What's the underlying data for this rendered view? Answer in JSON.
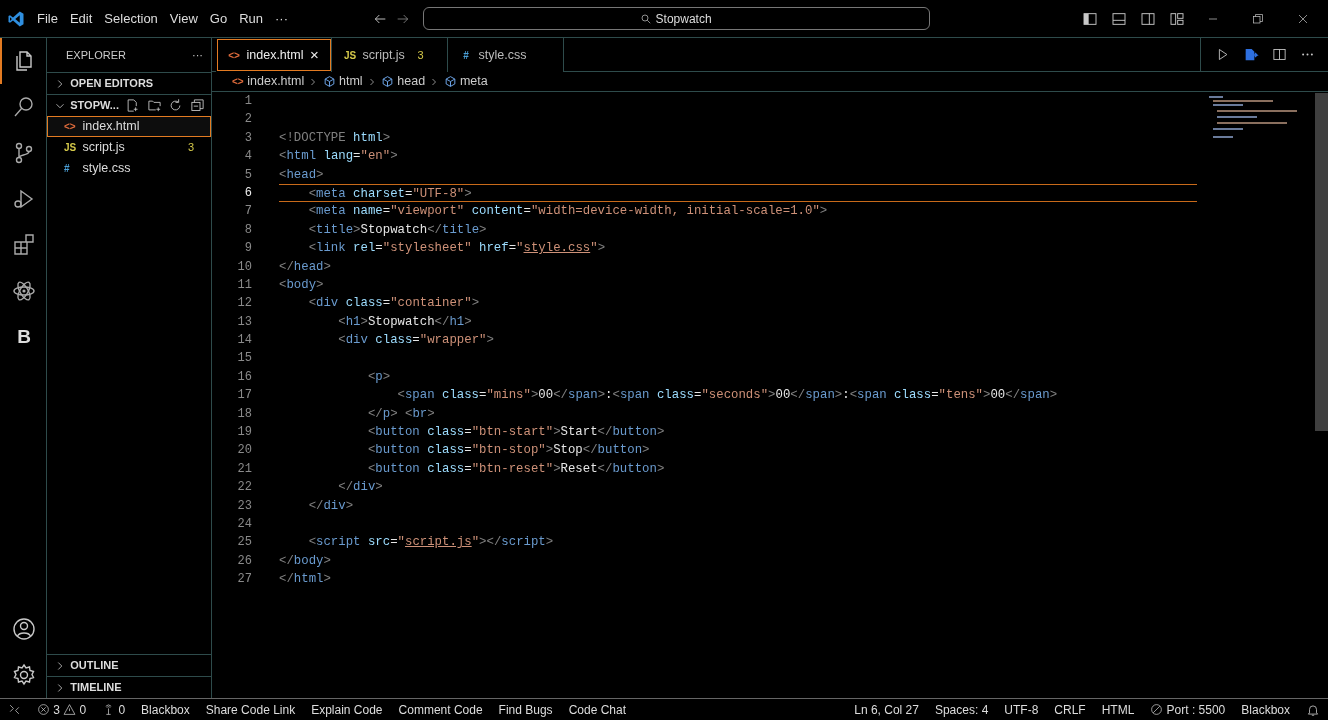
{
  "title_bar": {
    "menu": [
      "File",
      "Edit",
      "Selection",
      "View",
      "Go",
      "Run",
      "···"
    ],
    "search": {
      "value": "Stopwatch"
    }
  },
  "activity_bar": {
    "items": [
      {
        "kind": "files",
        "selected": true
      },
      {
        "kind": "search",
        "selected": false
      },
      {
        "kind": "source-control",
        "selected": false
      },
      {
        "kind": "run",
        "selected": false
      },
      {
        "kind": "extensions",
        "selected": false
      },
      {
        "kind": "atom",
        "selected": false
      },
      {
        "kind": "letter",
        "label": "B",
        "selected": false
      }
    ],
    "bottom": [
      {
        "kind": "account"
      },
      {
        "kind": "settings"
      }
    ]
  },
  "sidebar": {
    "title": "EXPLORER",
    "more": "···",
    "sections": [
      {
        "label": "OPEN EDITORS",
        "expanded": false
      },
      {
        "label": "STOPW...",
        "expanded": true
      }
    ],
    "files": [
      {
        "icon": "<>",
        "kind": "html",
        "name": "index.html",
        "selected": true
      },
      {
        "icon": "JS",
        "kind": "js",
        "name": "script.js",
        "badge": "3",
        "selected": false
      },
      {
        "icon": "#",
        "kind": "css",
        "name": "style.css",
        "selected": false
      }
    ],
    "bottom_sections": [
      {
        "label": "OUTLINE",
        "expanded": false
      },
      {
        "label": "TIMELINE",
        "expanded": false
      }
    ]
  },
  "tabs": [
    {
      "icon": "<>",
      "kind": "html",
      "label": "index.html",
      "close": "×",
      "selected": true
    },
    {
      "icon": "JS",
      "kind": "js",
      "label": "script.js",
      "badge": "3",
      "selected": false
    },
    {
      "icon": "#",
      "kind": "css",
      "label": "style.css",
      "selected": false
    }
  ],
  "breadcrumbs": [
    {
      "kind": "file",
      "icon": "<>",
      "label": "index.html"
    },
    {
      "kind": "element",
      "label": "html"
    },
    {
      "kind": "element",
      "label": "head"
    },
    {
      "kind": "element",
      "label": "meta"
    }
  ],
  "editor": {
    "lines": [
      {
        "number": "1",
        "current": false
      },
      {
        "number": "2",
        "current": false
      },
      {
        "number": "3",
        "current": false,
        "tokens": [
          {
            "kind": "punct",
            "text": "<!DOCTYPE"
          },
          {
            "kind": "attr",
            "text": " html"
          },
          {
            "kind": "punct",
            "text": ">"
          }
        ]
      },
      {
        "number": "4",
        "current": false,
        "tokens": [
          {
            "kind": "punct",
            "text": "<"
          },
          {
            "kind": "tag",
            "text": "html"
          },
          {
            "kind": "attr",
            "text": " lang"
          },
          {
            "kind": "text",
            "text": "="
          },
          {
            "kind": "value",
            "text": "\"en\""
          },
          {
            "kind": "punct",
            "text": ">"
          }
        ]
      },
      {
        "number": "5",
        "current": false,
        "tokens": [
          {
            "kind": "punct",
            "text": "<"
          },
          {
            "kind": "tag",
            "text": "head"
          },
          {
            "kind": "punct",
            "text": ">"
          }
        ]
      },
      {
        "number": "6",
        "current": true,
        "tokens": [
          {
            "kind": "punct",
            "text": "    <"
          },
          {
            "kind": "tag",
            "text": "meta"
          },
          {
            "kind": "attr",
            "text": " charset"
          },
          {
            "kind": "text",
            "text": "="
          },
          {
            "kind": "value",
            "text": "\"UTF-8\""
          },
          {
            "kind": "punct",
            "text": ">"
          }
        ]
      },
      {
        "number": "7",
        "current": false,
        "tokens": [
          {
            "kind": "punct",
            "text": "    <"
          },
          {
            "kind": "tag",
            "text": "meta"
          },
          {
            "kind": "attr",
            "text": " name"
          },
          {
            "kind": "text",
            "text": "="
          },
          {
            "kind": "value",
            "text": "\"viewport\""
          },
          {
            "kind": "attr",
            "text": " content"
          },
          {
            "kind": "text",
            "text": "="
          },
          {
            "kind": "value",
            "text": "\"width=device-width, initial-scale=1.0\""
          },
          {
            "kind": "punct",
            "text": ">"
          }
        ]
      },
      {
        "number": "8",
        "current": false,
        "tokens": [
          {
            "kind": "punct",
            "text": "    <"
          },
          {
            "kind": "tag",
            "text": "title"
          },
          {
            "kind": "punct",
            "text": ">"
          },
          {
            "kind": "text",
            "text": "Stopwatch"
          },
          {
            "kind": "punct",
            "text": "</"
          },
          {
            "kind": "tag",
            "text": "title"
          },
          {
            "kind": "punct",
            "text": ">"
          }
        ]
      },
      {
        "number": "9",
        "current": false,
        "tokens": [
          {
            "kind": "punct",
            "text": "    <"
          },
          {
            "kind": "tag",
            "text": "link"
          },
          {
            "kind": "attr",
            "text": " rel"
          },
          {
            "kind": "text",
            "text": "="
          },
          {
            "kind": "value",
            "text": "\"stylesheet\""
          },
          {
            "kind": "attr",
            "text": " href"
          },
          {
            "kind": "text",
            "text": "="
          },
          {
            "kind": "value",
            "text": "\""
          },
          {
            "kind": "link",
            "text": "style.css"
          },
          {
            "kind": "value",
            "text": "\""
          },
          {
            "kind": "punct",
            "text": ">"
          }
        ]
      },
      {
        "number": "10",
        "current": false,
        "tokens": [
          {
            "kind": "punct",
            "text": "</"
          },
          {
            "kind": "tag",
            "text": "head"
          },
          {
            "kind": "punct",
            "text": ">"
          }
        ]
      },
      {
        "number": "11",
        "current": false,
        "tokens": [
          {
            "kind": "punct",
            "text": "<"
          },
          {
            "kind": "tag",
            "text": "body"
          },
          {
            "kind": "punct",
            "text": ">"
          }
        ]
      },
      {
        "number": "12",
        "current": false,
        "tokens": [
          {
            "kind": "punct",
            "text": "    <"
          },
          {
            "kind": "tag",
            "text": "div"
          },
          {
            "kind": "attr",
            "text": " class"
          },
          {
            "kind": "text",
            "text": "="
          },
          {
            "kind": "value",
            "text": "\"container\""
          },
          {
            "kind": "punct",
            "text": ">"
          }
        ]
      },
      {
        "number": "13",
        "current": false,
        "tokens": [
          {
            "kind": "punct",
            "text": "        <"
          },
          {
            "kind": "tag",
            "text": "h1"
          },
          {
            "kind": "punct",
            "text": ">"
          },
          {
            "kind": "text",
            "text": "Stopwatch"
          },
          {
            "kind": "punct",
            "text": "</"
          },
          {
            "kind": "tag",
            "text": "h1"
          },
          {
            "kind": "punct",
            "text": ">"
          }
        ]
      },
      {
        "number": "14",
        "current": false,
        "tokens": [
          {
            "kind": "punct",
            "text": "        <"
          },
          {
            "kind": "tag",
            "text": "div"
          },
          {
            "kind": "attr",
            "text": " class"
          },
          {
            "kind": "text",
            "text": "="
          },
          {
            "kind": "value",
            "text": "\"wrapper\""
          },
          {
            "kind": "punct",
            "text": ">"
          }
        ]
      },
      {
        "number": "15",
        "current": false
      },
      {
        "number": "16",
        "current": false,
        "tokens": [
          {
            "kind": "punct",
            "text": "            <"
          },
          {
            "kind": "tag",
            "text": "p"
          },
          {
            "kind": "punct",
            "text": ">"
          }
        ]
      },
      {
        "number": "17",
        "current": false,
        "tokens": [
          {
            "kind": "punct",
            "text": "                <"
          },
          {
            "kind": "tag",
            "text": "span"
          },
          {
            "kind": "attr",
            "text": " class"
          },
          {
            "kind": "text",
            "text": "="
          },
          {
            "kind": "value",
            "text": "\"mins\""
          },
          {
            "kind": "punct",
            "text": ">"
          },
          {
            "kind": "text",
            "text": "00"
          },
          {
            "kind": "punct",
            "text": "</"
          },
          {
            "kind": "tag",
            "text": "span"
          },
          {
            "kind": "punct",
            "text": ">"
          },
          {
            "kind": "text",
            "text": ":"
          },
          {
            "kind": "punct",
            "text": "<"
          },
          {
            "kind": "tag",
            "text": "span"
          },
          {
            "kind": "attr",
            "text": " class"
          },
          {
            "kind": "text",
            "text": "="
          },
          {
            "kind": "value",
            "text": "\"seconds\""
          },
          {
            "kind": "punct",
            "text": ">"
          },
          {
            "kind": "text",
            "text": "00"
          },
          {
            "kind": "punct",
            "text": "</"
          },
          {
            "kind": "tag",
            "text": "span"
          },
          {
            "kind": "punct",
            "text": ">"
          },
          {
            "kind": "text",
            "text": ":"
          },
          {
            "kind": "punct",
            "text": "<"
          },
          {
            "kind": "tag",
            "text": "span"
          },
          {
            "kind": "attr",
            "text": " class"
          },
          {
            "kind": "text",
            "text": "="
          },
          {
            "kind": "value",
            "text": "\"tens\""
          },
          {
            "kind": "punct",
            "text": ">"
          },
          {
            "kind": "text",
            "text": "00"
          },
          {
            "kind": "punct",
            "text": "</"
          },
          {
            "kind": "tag",
            "text": "span"
          },
          {
            "kind": "punct",
            "text": ">"
          }
        ]
      },
      {
        "number": "18",
        "current": false,
        "tokens": [
          {
            "kind": "punct",
            "text": "            </"
          },
          {
            "kind": "tag",
            "text": "p"
          },
          {
            "kind": "punct",
            "text": "> <"
          },
          {
            "kind": "tag",
            "text": "br"
          },
          {
            "kind": "punct",
            "text": ">"
          }
        ]
      },
      {
        "number": "19",
        "current": false,
        "tokens": [
          {
            "kind": "punct",
            "text": "            <"
          },
          {
            "kind": "tag",
            "text": "button"
          },
          {
            "kind": "attr",
            "text": " class"
          },
          {
            "kind": "text",
            "text": "="
          },
          {
            "kind": "value",
            "text": "\"btn-start\""
          },
          {
            "kind": "punct",
            "text": ">"
          },
          {
            "kind": "text",
            "text": "Start"
          },
          {
            "kind": "punct",
            "text": "</"
          },
          {
            "kind": "tag",
            "text": "button"
          },
          {
            "kind": "punct",
            "text": ">"
          }
        ]
      },
      {
        "number": "20",
        "current": false,
        "tokens": [
          {
            "kind": "punct",
            "text": "            <"
          },
          {
            "kind": "tag",
            "text": "button"
          },
          {
            "kind": "attr",
            "text": " class"
          },
          {
            "kind": "text",
            "text": "="
          },
          {
            "kind": "value",
            "text": "\"btn-stop\""
          },
          {
            "kind": "punct",
            "text": ">"
          },
          {
            "kind": "text",
            "text": "Stop"
          },
          {
            "kind": "punct",
            "text": "</"
          },
          {
            "kind": "tag",
            "text": "button"
          },
          {
            "kind": "punct",
            "text": ">"
          }
        ]
      },
      {
        "number": "21",
        "current": false,
        "tokens": [
          {
            "kind": "punct",
            "text": "            <"
          },
          {
            "kind": "tag",
            "text": "button"
          },
          {
            "kind": "attr",
            "text": " class"
          },
          {
            "kind": "text",
            "text": "="
          },
          {
            "kind": "value",
            "text": "\"btn-reset\""
          },
          {
            "kind": "punct",
            "text": ">"
          },
          {
            "kind": "text",
            "text": "Reset"
          },
          {
            "kind": "punct",
            "text": "</"
          },
          {
            "kind": "tag",
            "text": "button"
          },
          {
            "kind": "punct",
            "text": ">"
          }
        ]
      },
      {
        "number": "22",
        "current": false,
        "tokens": [
          {
            "kind": "punct",
            "text": "        </"
          },
          {
            "kind": "tag",
            "text": "div"
          },
          {
            "kind": "punct",
            "text": ">"
          }
        ]
      },
      {
        "number": "23",
        "current": false,
        "tokens": [
          {
            "kind": "punct",
            "text": "    </"
          },
          {
            "kind": "tag",
            "text": "div"
          },
          {
            "kind": "punct",
            "text": ">"
          }
        ]
      },
      {
        "number": "24",
        "current": false
      },
      {
        "number": "25",
        "current": false,
        "tokens": [
          {
            "kind": "punct",
            "text": "    <"
          },
          {
            "kind": "tag",
            "text": "script"
          },
          {
            "kind": "attr",
            "text": " src"
          },
          {
            "kind": "text",
            "text": "="
          },
          {
            "kind": "value",
            "text": "\""
          },
          {
            "kind": "link",
            "text": "script.js"
          },
          {
            "kind": "value",
            "text": "\""
          },
          {
            "kind": "punct",
            "text": "></"
          },
          {
            "kind": "tag",
            "text": "script"
          },
          {
            "kind": "punct",
            "text": ">"
          }
        ]
      },
      {
        "number": "26",
        "current": false,
        "tokens": [
          {
            "kind": "punct",
            "text": "</"
          },
          {
            "kind": "tag",
            "text": "body"
          },
          {
            "kind": "punct",
            "text": ">"
          }
        ]
      },
      {
        "number": "27",
        "current": false,
        "tokens": [
          {
            "kind": "punct",
            "text": "</"
          },
          {
            "kind": "tag",
            "text": "html"
          },
          {
            "kind": "punct",
            "text": ">"
          }
        ]
      }
    ]
  },
  "status_bar": {
    "left": [
      {
        "kind": "remote"
      },
      {
        "kind": "problems",
        "errors": "3",
        "warnings": "0"
      },
      {
        "kind": "ports",
        "text": "0"
      },
      {
        "kind": "text",
        "text": "Blackbox"
      },
      {
        "kind": "text",
        "text": "Share Code Link"
      },
      {
        "kind": "text",
        "text": "Explain Code"
      },
      {
        "kind": "text",
        "text": "Comment Code"
      },
      {
        "kind": "text",
        "text": "Find Bugs"
      },
      {
        "kind": "text",
        "text": "Code Chat"
      }
    ],
    "right": [
      {
        "kind": "text",
        "text": "Ln 6, Col 27"
      },
      {
        "kind": "text",
        "text": "Spaces: 4"
      },
      {
        "kind": "text",
        "text": "UTF-8"
      },
      {
        "kind": "text",
        "text": "CRLF"
      },
      {
        "kind": "text",
        "text": "HTML"
      },
      {
        "kind": "port",
        "text": "Port : 5500"
      },
      {
        "kind": "text",
        "text": "Blackbox"
      },
      {
        "kind": "bell"
      }
    ]
  }
}
